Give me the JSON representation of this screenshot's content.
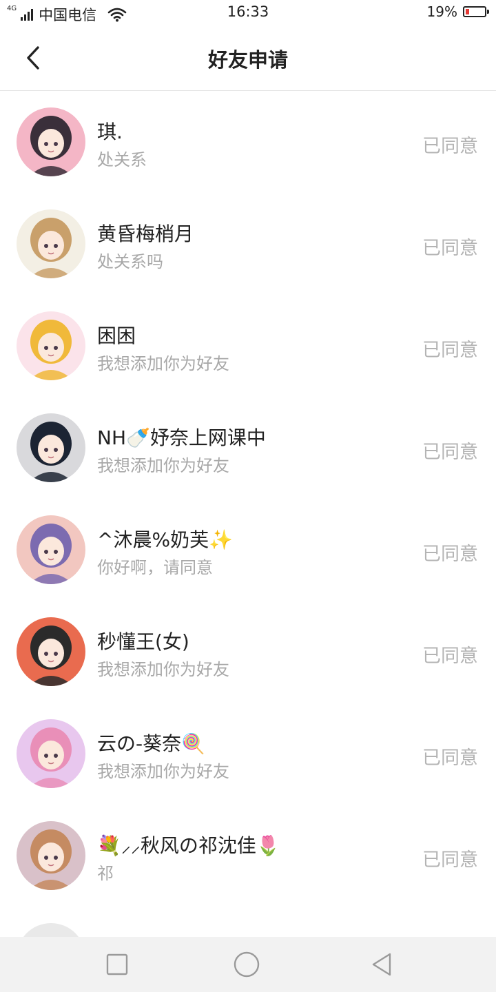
{
  "status_bar": {
    "network": "4G",
    "carrier": "中国电信",
    "time": "16:33",
    "battery_percent_text": "19%",
    "battery_level": 0.19,
    "battery_color": "#e53935"
  },
  "header": {
    "title": "好友申请",
    "back_icon": "chevron-left-icon"
  },
  "requests": [
    {
      "name": "琪.",
      "message": "处关系",
      "status": "已同意",
      "avatar_colors": [
        "#f4b6c6",
        "#3a2f3a"
      ]
    },
    {
      "name": "黄昏梅梢月",
      "message": "处关系吗",
      "status": "已同意",
      "avatar_colors": [
        "#f3efe4",
        "#c9a06b"
      ]
    },
    {
      "name": "困困",
      "message": "我想添加你为好友",
      "status": "已同意",
      "avatar_colors": [
        "#fbe3ea",
        "#f0b93a"
      ]
    },
    {
      "name": "NH🍼妤奈上网课中",
      "message": "我想添加你为好友",
      "status": "已同意",
      "avatar_colors": [
        "#d9d9dc",
        "#1c2433"
      ]
    },
    {
      "name": "^沐晨%奶芙✨",
      "message": "你好啊，请同意",
      "status": "已同意",
      "avatar_colors": [
        "#f2c7c0",
        "#7c6bb0"
      ]
    },
    {
      "name": "秒懂王(女)",
      "message": "我想添加你为好友",
      "status": "已同意",
      "avatar_colors": [
        "#e96b4f",
        "#2b2b2b"
      ]
    },
    {
      "name": "云の-葵奈🍭",
      "message": "我想添加你为好友",
      "status": "已同意",
      "avatar_colors": [
        "#e8c7ee",
        "#e98fb8"
      ]
    },
    {
      "name": "💐⸝⸝秋风の祁沈佳🌷",
      "message": "祁",
      "status": "已同意",
      "avatar_colors": [
        "#d9c1c9",
        "#c58b62"
      ]
    }
  ],
  "nav_bar": {
    "buttons": [
      "square-icon",
      "circle-icon",
      "triangle-back-icon"
    ]
  }
}
